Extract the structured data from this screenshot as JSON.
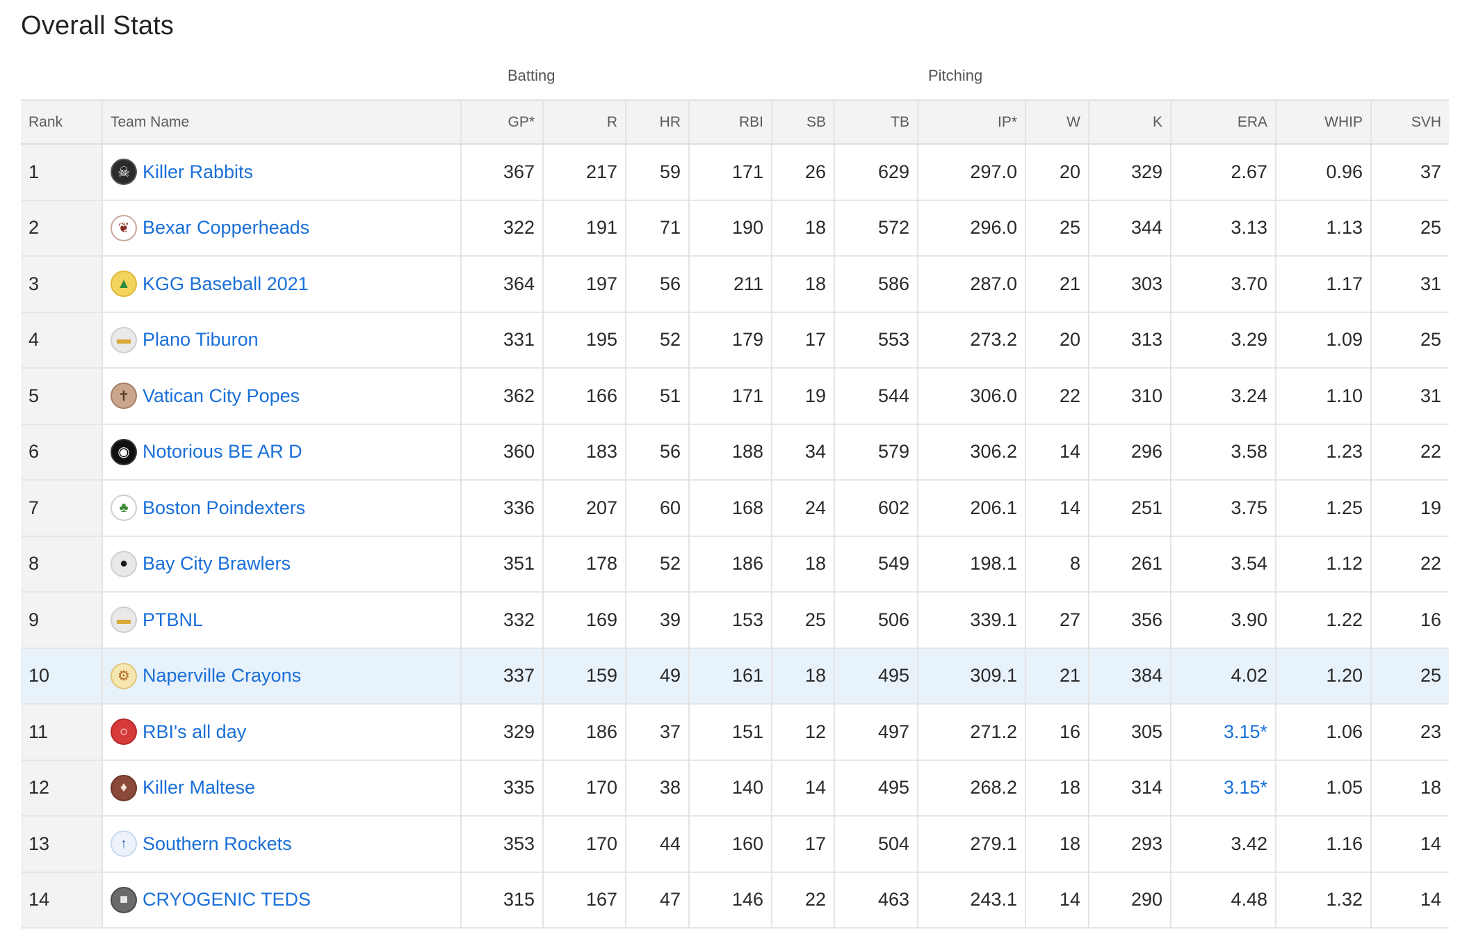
{
  "page_title": "Overall Stats",
  "group_headers": {
    "batting": "Batting",
    "pitching": "Pitching"
  },
  "columns": {
    "rank": "Rank",
    "team": "Team Name",
    "gp": "GP*",
    "r": "R",
    "hr": "HR",
    "rbi": "RBI",
    "sb": "SB",
    "tb": "TB",
    "ip": "IP*",
    "w": "W",
    "k": "K",
    "era": "ERA",
    "whip": "WHIP",
    "svh": "SVH"
  },
  "highlight_rank": "10",
  "rows": [
    {
      "rank": "1",
      "team": "Killer Rabbits",
      "icon": "killer-rabbits-logo",
      "gp": "367",
      "r": "217",
      "hr": "59",
      "rbi": "171",
      "sb": "26",
      "tb": "629",
      "ip": "297.0",
      "w": "20",
      "k": "329",
      "era": "2.67",
      "whip": "0.96",
      "svh": "37"
    },
    {
      "rank": "2",
      "team": "Bexar Copperheads",
      "icon": "bexar-copperheads-logo",
      "gp": "322",
      "r": "191",
      "hr": "71",
      "rbi": "190",
      "sb": "18",
      "tb": "572",
      "ip": "296.0",
      "w": "25",
      "k": "344",
      "era": "3.13",
      "whip": "1.13",
      "svh": "25"
    },
    {
      "rank": "3",
      "team": "KGG Baseball 2021",
      "icon": "kgg-baseball-logo",
      "gp": "364",
      "r": "197",
      "hr": "56",
      "rbi": "211",
      "sb": "18",
      "tb": "586",
      "ip": "287.0",
      "w": "21",
      "k": "303",
      "era": "3.70",
      "whip": "1.17",
      "svh": "31"
    },
    {
      "rank": "4",
      "team": "Plano Tiburon",
      "icon": "plano-tiburon-logo",
      "gp": "331",
      "r": "195",
      "hr": "52",
      "rbi": "179",
      "sb": "17",
      "tb": "553",
      "ip": "273.2",
      "w": "20",
      "k": "313",
      "era": "3.29",
      "whip": "1.09",
      "svh": "25"
    },
    {
      "rank": "5",
      "team": "Vatican City Popes",
      "icon": "vatican-city-popes-logo",
      "gp": "362",
      "r": "166",
      "hr": "51",
      "rbi": "171",
      "sb": "19",
      "tb": "544",
      "ip": "306.0",
      "w": "22",
      "k": "310",
      "era": "3.24",
      "whip": "1.10",
      "svh": "31"
    },
    {
      "rank": "6",
      "team": "Notorious BE AR D",
      "icon": "notorious-bear-logo",
      "gp": "360",
      "r": "183",
      "hr": "56",
      "rbi": "188",
      "sb": "34",
      "tb": "579",
      "ip": "306.2",
      "w": "14",
      "k": "296",
      "era": "3.58",
      "whip": "1.23",
      "svh": "22"
    },
    {
      "rank": "7",
      "team": "Boston Poindexters",
      "icon": "boston-poindexters-logo",
      "gp": "336",
      "r": "207",
      "hr": "60",
      "rbi": "168",
      "sb": "24",
      "tb": "602",
      "ip": "206.1",
      "w": "14",
      "k": "251",
      "era": "3.75",
      "whip": "1.25",
      "svh": "19"
    },
    {
      "rank": "8",
      "team": "Bay City Brawlers",
      "icon": "bay-city-brawlers-logo",
      "gp": "351",
      "r": "178",
      "hr": "52",
      "rbi": "186",
      "sb": "18",
      "tb": "549",
      "ip": "198.1",
      "w": "8",
      "k": "261",
      "era": "3.54",
      "whip": "1.12",
      "svh": "22"
    },
    {
      "rank": "9",
      "team": "PTBNL",
      "icon": "ptbnl-logo",
      "gp": "332",
      "r": "169",
      "hr": "39",
      "rbi": "153",
      "sb": "25",
      "tb": "506",
      "ip": "339.1",
      "w": "27",
      "k": "356",
      "era": "3.90",
      "whip": "1.22",
      "svh": "16"
    },
    {
      "rank": "10",
      "team": "Naperville Crayons",
      "icon": "naperville-crayons-logo",
      "gp": "337",
      "r": "159",
      "hr": "49",
      "rbi": "161",
      "sb": "18",
      "tb": "495",
      "ip": "309.1",
      "w": "21",
      "k": "384",
      "era": "4.02",
      "whip": "1.20",
      "svh": "25"
    },
    {
      "rank": "11",
      "team": "RBI's all day",
      "icon": "rbis-all-day-logo",
      "gp": "329",
      "r": "186",
      "hr": "37",
      "rbi": "151",
      "sb": "12",
      "tb": "497",
      "ip": "271.2",
      "w": "16",
      "k": "305",
      "era": "3.15*",
      "era_link": true,
      "whip": "1.06",
      "svh": "23"
    },
    {
      "rank": "12",
      "team": "Killer Maltese",
      "icon": "killer-maltese-logo",
      "gp": "335",
      "r": "170",
      "hr": "38",
      "rbi": "140",
      "sb": "14",
      "tb": "495",
      "ip": "268.2",
      "w": "18",
      "k": "314",
      "era": "3.15*",
      "era_link": true,
      "whip": "1.05",
      "svh": "18"
    },
    {
      "rank": "13",
      "team": "Southern Rockets",
      "icon": "southern-rockets-logo",
      "gp": "353",
      "r": "170",
      "hr": "44",
      "rbi": "160",
      "sb": "17",
      "tb": "504",
      "ip": "279.1",
      "w": "18",
      "k": "293",
      "era": "3.42",
      "whip": "1.16",
      "svh": "14"
    },
    {
      "rank": "14",
      "team": "CRYOGENIC TEDS",
      "icon": "cryogenic-teds-logo",
      "gp": "315",
      "r": "167",
      "hr": "47",
      "rbi": "146",
      "sb": "22",
      "tb": "463",
      "ip": "243.1",
      "w": "14",
      "k": "290",
      "era": "4.48",
      "whip": "1.32",
      "svh": "14"
    }
  ],
  "colors": {
    "link": "#1a6fd8",
    "header_bg": "#f3f3f3",
    "highlight_row_bg": "#e8f2fa"
  }
}
